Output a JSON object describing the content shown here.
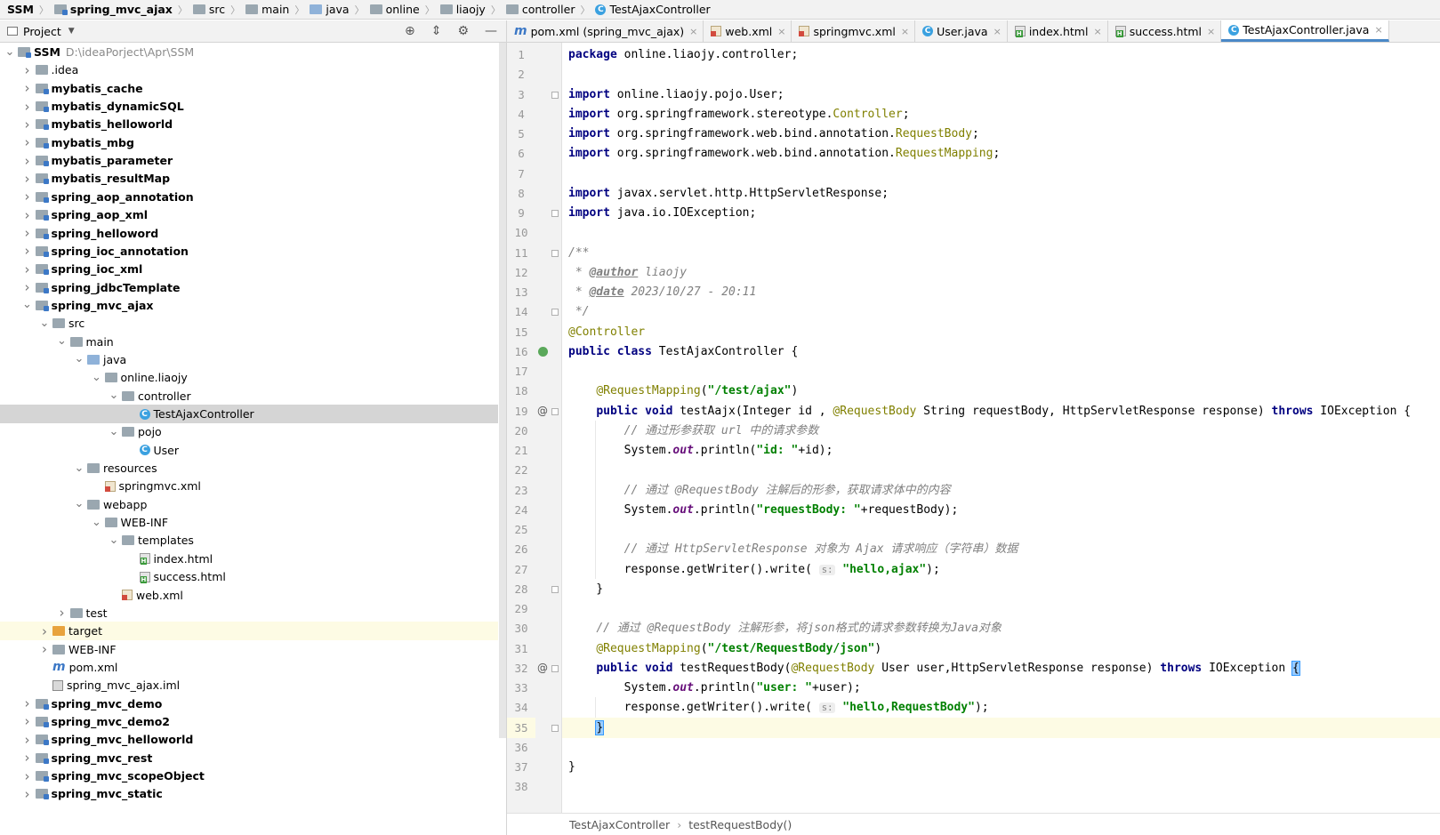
{
  "breadcrumb": [
    "SSM",
    "spring_mvc_ajax",
    "src",
    "main",
    "java",
    "online",
    "liaojy",
    "controller",
    "TestAjaxController"
  ],
  "project_panel": {
    "title": "Project",
    "tool_icons": [
      "crosshair-icon",
      "collapse-icon",
      "gear-icon",
      "minimize-icon"
    ]
  },
  "tree": [
    {
      "label": "SSM",
      "path": "D:\\ideaPorject\\Apr\\SSM",
      "depth": 0,
      "expanded": true,
      "icon": "module",
      "bold": true
    },
    {
      "label": ".idea",
      "depth": 1,
      "expanded": false,
      "icon": "folder"
    },
    {
      "label": "mybatis_cache",
      "depth": 1,
      "expanded": false,
      "icon": "module",
      "bold": true
    },
    {
      "label": "mybatis_dynamicSQL",
      "depth": 1,
      "expanded": false,
      "icon": "module",
      "bold": true
    },
    {
      "label": "mybatis_helloworld",
      "depth": 1,
      "expanded": false,
      "icon": "module",
      "bold": true
    },
    {
      "label": "mybatis_mbg",
      "depth": 1,
      "expanded": false,
      "icon": "module",
      "bold": true
    },
    {
      "label": "mybatis_parameter",
      "depth": 1,
      "expanded": false,
      "icon": "module",
      "bold": true
    },
    {
      "label": "mybatis_resultMap",
      "depth": 1,
      "expanded": false,
      "icon": "module",
      "bold": true
    },
    {
      "label": "spring_aop_annotation",
      "depth": 1,
      "expanded": false,
      "icon": "module",
      "bold": true
    },
    {
      "label": "spring_aop_xml",
      "depth": 1,
      "expanded": false,
      "icon": "module",
      "bold": true
    },
    {
      "label": "spring_helloword",
      "depth": 1,
      "expanded": false,
      "icon": "module",
      "bold": true
    },
    {
      "label": "spring_ioc_annotation",
      "depth": 1,
      "expanded": false,
      "icon": "module",
      "bold": true
    },
    {
      "label": "spring_ioc_xml",
      "depth": 1,
      "expanded": false,
      "icon": "module",
      "bold": true
    },
    {
      "label": "spring_jdbcTemplate",
      "depth": 1,
      "expanded": false,
      "icon": "module",
      "bold": true
    },
    {
      "label": "spring_mvc_ajax",
      "depth": 1,
      "expanded": true,
      "icon": "module",
      "bold": true
    },
    {
      "label": "src",
      "depth": 2,
      "expanded": true,
      "icon": "folder"
    },
    {
      "label": "main",
      "depth": 3,
      "expanded": true,
      "icon": "folder"
    },
    {
      "label": "java",
      "depth": 4,
      "expanded": true,
      "icon": "folder-blue"
    },
    {
      "label": "online.liaojy",
      "depth": 5,
      "expanded": true,
      "icon": "folder"
    },
    {
      "label": "controller",
      "depth": 6,
      "expanded": true,
      "icon": "folder"
    },
    {
      "label": "TestAjaxController",
      "depth": 7,
      "icon": "class",
      "selected": true
    },
    {
      "label": "pojo",
      "depth": 6,
      "expanded": true,
      "icon": "folder"
    },
    {
      "label": "User",
      "depth": 7,
      "icon": "class"
    },
    {
      "label": "resources",
      "depth": 4,
      "expanded": true,
      "icon": "folder"
    },
    {
      "label": "springmvc.xml",
      "depth": 5,
      "icon": "xml"
    },
    {
      "label": "webapp",
      "depth": 4,
      "expanded": true,
      "icon": "folder"
    },
    {
      "label": "WEB-INF",
      "depth": 5,
      "expanded": true,
      "icon": "folder"
    },
    {
      "label": "templates",
      "depth": 6,
      "expanded": true,
      "icon": "folder"
    },
    {
      "label": "index.html",
      "depth": 7,
      "icon": "html"
    },
    {
      "label": "success.html",
      "depth": 7,
      "icon": "html"
    },
    {
      "label": "web.xml",
      "depth": 6,
      "icon": "xml"
    },
    {
      "label": "test",
      "depth": 3,
      "expanded": false,
      "icon": "folder"
    },
    {
      "label": "target",
      "depth": 2,
      "expanded": false,
      "icon": "folder-orange",
      "highlight": true
    },
    {
      "label": "WEB-INF",
      "depth": 2,
      "expanded": false,
      "icon": "folder"
    },
    {
      "label": "pom.xml",
      "depth": 2,
      "icon": "maven"
    },
    {
      "label": "spring_mvc_ajax.iml",
      "depth": 2,
      "icon": "iml"
    },
    {
      "label": "spring_mvc_demo",
      "depth": 1,
      "expanded": false,
      "icon": "module",
      "bold": true
    },
    {
      "label": "spring_mvc_demo2",
      "depth": 1,
      "expanded": false,
      "icon": "module",
      "bold": true
    },
    {
      "label": "spring_mvc_helloworld",
      "depth": 1,
      "expanded": false,
      "icon": "module",
      "bold": true
    },
    {
      "label": "spring_mvc_rest",
      "depth": 1,
      "expanded": false,
      "icon": "module",
      "bold": true
    },
    {
      "label": "spring_mvc_scopeObject",
      "depth": 1,
      "expanded": false,
      "icon": "module",
      "bold": true
    },
    {
      "label": "spring_mvc_static",
      "depth": 1,
      "expanded": false,
      "icon": "module",
      "bold": true
    }
  ],
  "tabs": [
    {
      "label": "pom.xml (spring_mvc_ajax)",
      "icon": "maven"
    },
    {
      "label": "web.xml",
      "icon": "xml"
    },
    {
      "label": "springmvc.xml",
      "icon": "xml"
    },
    {
      "label": "User.java",
      "icon": "class"
    },
    {
      "label": "index.html",
      "icon": "html"
    },
    {
      "label": "success.html",
      "icon": "html"
    },
    {
      "label": "TestAjaxController.java",
      "icon": "class",
      "active": true
    }
  ],
  "code": [
    [
      [
        "kw",
        "package"
      ],
      [
        "t",
        " online.liaojy.controller;"
      ]
    ],
    [],
    [
      [
        "kw",
        "import"
      ],
      [
        "t",
        " online.liaojy.pojo.User;"
      ]
    ],
    [
      [
        "kw",
        "import"
      ],
      [
        "t",
        " org.springframework.stereotype."
      ],
      [
        "ann",
        "Controller"
      ],
      [
        "t",
        ";"
      ]
    ],
    [
      [
        "kw",
        "import"
      ],
      [
        "t",
        " org.springframework.web.bind.annotation."
      ],
      [
        "ann",
        "RequestBody"
      ],
      [
        "t",
        ";"
      ]
    ],
    [
      [
        "kw",
        "import"
      ],
      [
        "t",
        " org.springframework.web.bind.annotation."
      ],
      [
        "ann",
        "RequestMapping"
      ],
      [
        "t",
        ";"
      ]
    ],
    [],
    [
      [
        "kw",
        "import"
      ],
      [
        "t",
        " javax.servlet.http.HttpServletResponse;"
      ]
    ],
    [
      [
        "kw",
        "import"
      ],
      [
        "t",
        " java.io.IOException;"
      ]
    ],
    [],
    [
      [
        "cmt",
        "/**"
      ]
    ],
    [
      [
        "cmt",
        " * "
      ],
      [
        "doctag",
        "@author"
      ],
      [
        "cmt",
        " liaojy"
      ]
    ],
    [
      [
        "cmt",
        " * "
      ],
      [
        "doctag",
        "@date"
      ],
      [
        "cmt",
        " 2023/10/27 - 20:11"
      ]
    ],
    [
      [
        "cmt",
        " */"
      ]
    ],
    [
      [
        "ann",
        "@Controller"
      ]
    ],
    [
      [
        "kw",
        "public class"
      ],
      [
        "t",
        " TestAjaxController {"
      ]
    ],
    [],
    [
      [
        "t",
        "    "
      ],
      [
        "ann",
        "@RequestMapping"
      ],
      [
        "t",
        "("
      ],
      [
        "str",
        "\"/test/ajax\""
      ],
      [
        "t",
        ")"
      ]
    ],
    [
      [
        "t",
        "    "
      ],
      [
        "kw",
        "public void"
      ],
      [
        "t",
        " testAajx(Integer id , "
      ],
      [
        "ann",
        "@RequestBody"
      ],
      [
        "t",
        " String requestBody, HttpServletResponse response) "
      ],
      [
        "kw",
        "throws"
      ],
      [
        "t",
        " IOException {"
      ]
    ],
    [
      [
        "t",
        "        "
      ],
      [
        "cmt",
        "// 通过形参获取 url 中的请求参数"
      ]
    ],
    [
      [
        "t",
        "        System."
      ],
      [
        "fld",
        "out"
      ],
      [
        "t",
        ".println("
      ],
      [
        "str",
        "\"id: \""
      ],
      [
        "t",
        "+id);"
      ]
    ],
    [],
    [
      [
        "t",
        "        "
      ],
      [
        "cmt",
        "// 通过 @RequestBody 注解后的形参，获取请求体中的内容"
      ]
    ],
    [
      [
        "t",
        "        System."
      ],
      [
        "fld",
        "out"
      ],
      [
        "t",
        ".println("
      ],
      [
        "str",
        "\"requestBody: \""
      ],
      [
        "t",
        "+requestBody);"
      ]
    ],
    [],
    [
      [
        "t",
        "        "
      ],
      [
        "cmt",
        "// 通过 HttpServletResponse 对象为 Ajax 请求响应（字符串）数据"
      ]
    ],
    [
      [
        "t",
        "        response.getWriter().write( "
      ],
      [
        "hint",
        "s:"
      ],
      [
        "t",
        " "
      ],
      [
        "str",
        "\"hello,ajax\""
      ],
      [
        "t",
        ");"
      ]
    ],
    [
      [
        "t",
        "    }"
      ]
    ],
    [],
    [
      [
        "t",
        "    "
      ],
      [
        "cmt",
        "// 通过 @RequestBody 注解形参，将json格式的请求参数转换为Java对象"
      ]
    ],
    [
      [
        "t",
        "    "
      ],
      [
        "ann",
        "@RequestMapping"
      ],
      [
        "t",
        "("
      ],
      [
        "str",
        "\"/test/RequestBody/json\""
      ],
      [
        "t",
        ")"
      ]
    ],
    [
      [
        "t",
        "    "
      ],
      [
        "kw",
        "public void"
      ],
      [
        "t",
        " testRequestBody("
      ],
      [
        "ann",
        "@RequestBody"
      ],
      [
        "t",
        " User user,HttpServletResponse response) "
      ],
      [
        "kw",
        "throws"
      ],
      [
        "t",
        " IOException "
      ],
      [
        "bh",
        "{"
      ]
    ],
    [
      [
        "t",
        "        System."
      ],
      [
        "fld",
        "out"
      ],
      [
        "t",
        ".println("
      ],
      [
        "str",
        "\"user: \""
      ],
      [
        "t",
        "+user);"
      ]
    ],
    [
      [
        "t",
        "        response.getWriter().write( "
      ],
      [
        "hint",
        "s:"
      ],
      [
        "t",
        " "
      ],
      [
        "str",
        "\"hello,RequestBody\""
      ],
      [
        "t",
        ");"
      ]
    ],
    [
      [
        "t",
        "    "
      ],
      [
        "bh",
        "}"
      ]
    ],
    [],
    [
      [
        "t",
        "}"
      ]
    ],
    []
  ],
  "current_line": 35,
  "status_path": [
    "TestAjaxController",
    "testRequestBody()"
  ]
}
